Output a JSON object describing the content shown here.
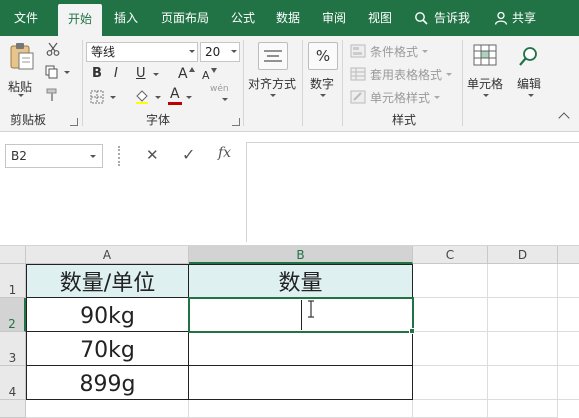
{
  "tabs": {
    "file": "文件",
    "home": "开始",
    "insert": "插入",
    "page_layout": "页面布局",
    "formulas": "公式",
    "data": "数据",
    "review": "审阅",
    "view": "视图",
    "tell_me": "告诉我",
    "share": "共享"
  },
  "ribbon": {
    "clipboard": {
      "paste": "粘贴",
      "group": "剪贴板"
    },
    "font": {
      "name": "等线",
      "size": "20",
      "group": "字体",
      "bold": "B",
      "italic": "I",
      "underline": "U",
      "grow": "A",
      "shrink": "A",
      "color_letter": "A",
      "font_color": "#c00000",
      "phonetic": "wén"
    },
    "alignment": {
      "label": "对齐方式"
    },
    "number": {
      "label": "数字",
      "symbol": "%"
    },
    "styles": {
      "conditional": "条件格式",
      "table_format": "套用表格格式",
      "cell_styles": "单元格样式",
      "group": "样式"
    },
    "cells": {
      "label": "单元格"
    },
    "editing": {
      "label": "编辑"
    }
  },
  "formula_bar": {
    "name_box": "B2",
    "cancel": "✕",
    "confirm": "✓",
    "fx": "fx",
    "value": ""
  },
  "sheet": {
    "columns": [
      "A",
      "B",
      "C",
      "D"
    ],
    "rows": [
      "1",
      "2",
      "3",
      "4"
    ],
    "cells": {
      "A1": "数量/单位",
      "B1": "数量",
      "A2": "90kg",
      "B2": "",
      "A3": "70kg",
      "B3": "",
      "A4": "899g",
      "B4": ""
    }
  },
  "colors": {
    "accent": "#217346",
    "header_fill": "#dff0f1"
  }
}
